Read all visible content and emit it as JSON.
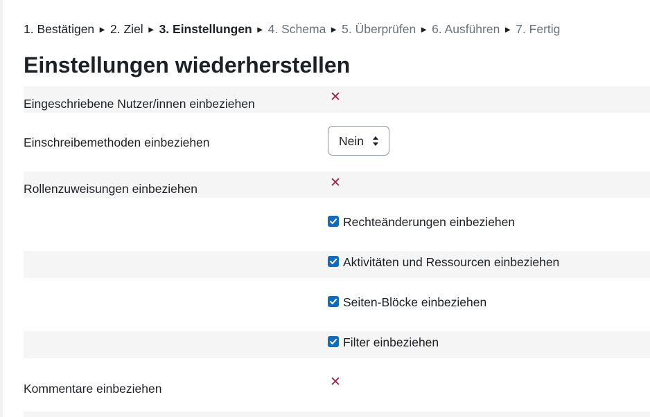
{
  "stepper": {
    "steps": [
      {
        "label": "1. Bestätigen"
      },
      {
        "label": "2. Ziel"
      },
      {
        "label": "3. Einstellungen"
      },
      {
        "label": "4. Schema"
      },
      {
        "label": "5. Überprüfen"
      },
      {
        "label": "6. Ausführen"
      },
      {
        "label": "7. Fertig"
      }
    ],
    "separator": "►"
  },
  "page_title": "Einstellungen wiederherstellen",
  "settings": {
    "enrolled_users": {
      "label": "Eingeschriebene Nutzer/innen einbeziehen",
      "value": "✕"
    },
    "enrol_methods": {
      "label": "Einschreibemethoden einbeziehen",
      "selected": "Nein"
    },
    "role_assignments": {
      "label": "Rollenzuweisungen einbeziehen",
      "value": "✕"
    },
    "permissions": {
      "label": "Rechteänderungen einbeziehen",
      "checked": true
    },
    "activities": {
      "label": "Aktivitäten und Ressourcen einbeziehen",
      "checked": true
    },
    "blocks": {
      "label": "Seiten-Blöcke einbeziehen",
      "checked": true
    },
    "filters": {
      "label": "Filter einbeziehen",
      "checked": true
    },
    "comments": {
      "label": "Kommentare einbeziehen",
      "value": "✕"
    }
  },
  "colors": {
    "accent": "#0f6cbf",
    "x_mark": "#a42046",
    "row_shade": "#f5f5f5"
  }
}
